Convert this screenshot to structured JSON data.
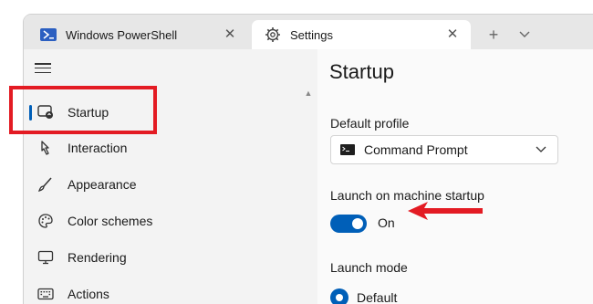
{
  "tabs": [
    {
      "label": "Windows PowerShell",
      "icon": "powershell-icon",
      "active": false
    },
    {
      "label": "Settings",
      "icon": "gear-icon",
      "active": true
    }
  ],
  "titlebar": {
    "new_tab": "+",
    "dropdown": "chevron-down-icon"
  },
  "sidebar": {
    "items": [
      {
        "label": "Startup",
        "icon": "startup-icon",
        "selected": true
      },
      {
        "label": "Interaction",
        "icon": "pointer-icon"
      },
      {
        "label": "Appearance",
        "icon": "brush-icon"
      },
      {
        "label": "Color schemes",
        "icon": "palette-icon"
      },
      {
        "label": "Rendering",
        "icon": "monitor-icon"
      },
      {
        "label": "Actions",
        "icon": "keyboard-icon"
      }
    ]
  },
  "main": {
    "title": "Startup",
    "default_profile_label": "Default profile",
    "default_profile_value": "Command Prompt",
    "launch_startup_label": "Launch on machine startup",
    "launch_startup_state": "On",
    "launch_mode_label": "Launch mode",
    "launch_mode_value": "Default"
  },
  "colors": {
    "accent": "#005fb8",
    "annotation": "#e31b23"
  }
}
